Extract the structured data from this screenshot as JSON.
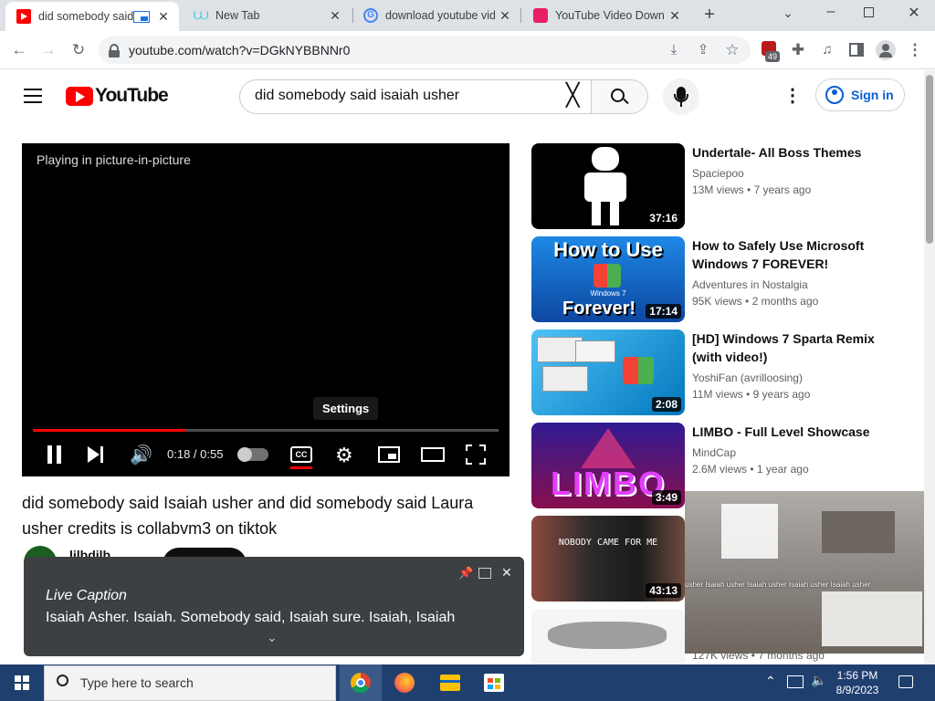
{
  "browser": {
    "tabs": [
      {
        "title": "did somebody said Isaiah usher",
        "active": true
      },
      {
        "title": "New Tab",
        "active": false
      },
      {
        "title": "download youtube video",
        "active": false
      },
      {
        "title": "YouTube Video Downloader",
        "active": false
      }
    ],
    "url": "youtube.com/watch?v=DGkNYBBNNr0",
    "extension_badge": "49"
  },
  "youtube": {
    "logo_text": "YouTube",
    "search_value": "did somebody said isaiah usher",
    "signin_label": "Sign in",
    "player": {
      "pip_message": "Playing in picture-in-picture",
      "time": "0:18 / 0:55",
      "tooltip": "Settings",
      "progress": 0.327
    },
    "video_title": "did somebody said Isaiah usher and did somebody said Laura usher credits is collabvm3 on tiktok",
    "channel_partial": "lilbdilb",
    "recommendations": [
      {
        "title": "Undertale- All Boss Themes",
        "channel": "Spaciepoo",
        "views": "13M views",
        "age": "7 years ago",
        "duration": "37:16"
      },
      {
        "title": "How to Safely Use Microsoft Windows 7 FOREVER!",
        "channel": "Adventures in Nostalgia",
        "views": "95K views",
        "age": "2 months ago",
        "duration": "17:14",
        "thumb_text_top": "How to Use",
        "thumb_text_bottom": "Forever!",
        "thumb_logo": "Windows 7"
      },
      {
        "title": "[HD] Windows 7 Sparta Remix (with video!)",
        "channel": "YoshiFan (avrilloosing)",
        "views": "11M views",
        "age": "9 years ago",
        "duration": "2:08"
      },
      {
        "title": "LIMBO - Full Level Showcase",
        "channel": "MindCap",
        "views": "2.6M views",
        "age": "1 year ago",
        "duration": "3:49",
        "thumb_text": "LIMBO"
      },
      {
        "title": "",
        "channel": "",
        "views": "",
        "age": "",
        "duration": "43:13",
        "thumb_text": "NOBODY CAME FOR ME"
      },
      {
        "views": "127K views",
        "age": "7 months ago"
      }
    ]
  },
  "live_caption": {
    "heading": "Live Caption",
    "text": "Isaiah Asher. Isaiah. Somebody said, Isaiah sure. Isaiah, Isaiah"
  },
  "pip_overlay_text": "usher Isaiah usher Isaiah usher Isaiah usher Isaiah usher",
  "taskbar": {
    "search_placeholder": "Type here to search",
    "time": "1:56 PM",
    "date": "8/9/2023"
  },
  "colors": {
    "youtube_red": "#ff0000",
    "link_blue": "#065fd4",
    "taskbar": "#1f3f6f"
  }
}
